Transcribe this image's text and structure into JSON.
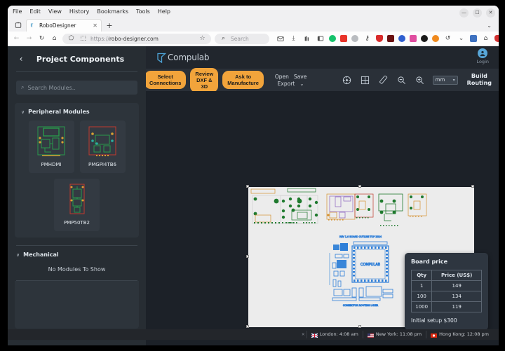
{
  "browser": {
    "menus": [
      "File",
      "Edit",
      "View",
      "History",
      "Bookmarks",
      "Tools",
      "Help"
    ],
    "window_controls": [
      {
        "name": "minimize",
        "glyph": "—"
      },
      {
        "name": "maximize",
        "glyph": "☐"
      },
      {
        "name": "close",
        "glyph": "✕"
      }
    ],
    "tab": {
      "title": "RoboDesigner",
      "favicon": "compulab-favicon",
      "close_glyph": "✕"
    },
    "new_tab_glyph": "+",
    "list_all_tabs_glyph": "⌄",
    "nav": {
      "back_glyph": "←",
      "forward_glyph": "→",
      "reload_glyph": "↻",
      "home_glyph": "⌂",
      "shield_glyph": "⬠",
      "lock_glyph": "⬚",
      "url_scheme": "https://",
      "url_host": "robo-designer.com",
      "bookmark_glyph": "☆",
      "search_placeholder": "Search",
      "search_glyph": "⌕"
    },
    "extensions": [
      {
        "name": "pocket-icon",
        "color": "#ffffff",
        "glyph": "✉"
      },
      {
        "name": "downloads-icon",
        "color": "#ffffff",
        "glyph": "⤓"
      },
      {
        "name": "library-icon",
        "color": "#ffffff",
        "glyph": "‖"
      },
      {
        "name": "sidebar-icon",
        "color": "#ffffff",
        "glyph": "◫"
      },
      {
        "name": "grammar-extension-icon",
        "color": "#15c26b",
        "glyph": ""
      },
      {
        "name": "red-extension-icon",
        "color": "#e8342a",
        "glyph": ""
      },
      {
        "name": "gray-extension-icon",
        "color": "#b9bcc0",
        "glyph": ""
      },
      {
        "name": "key-extension-icon",
        "color": "#ffffff",
        "glyph": "⚷"
      },
      {
        "name": "shield-extension-icon",
        "color": "#d92b2b",
        "glyph": ""
      },
      {
        "name": "dark-red-extension-icon",
        "color": "#6b1212",
        "glyph": ""
      },
      {
        "name": "blue-extension-icon",
        "color": "#2f5fd0",
        "glyph": ""
      },
      {
        "name": "pink-extension-icon",
        "color": "#e04ea0",
        "glyph": ""
      },
      {
        "name": "black-extension-icon",
        "color": "#1a1a1a",
        "glyph": ""
      },
      {
        "name": "orange-extension-icon",
        "color": "#f08a1e",
        "glyph": ""
      },
      {
        "name": "history-icon",
        "color": "#ffffff",
        "glyph": "↺"
      },
      {
        "name": "history-dropdown-icon",
        "color": "#ffffff",
        "glyph": "⌄"
      },
      {
        "name": "picture-extension-icon",
        "color": "#3f72c0",
        "glyph": ""
      },
      {
        "name": "home-extension-icon",
        "color": "#ffffff",
        "glyph": "⌂"
      },
      {
        "name": "heart-extension-icon",
        "color": "#d32f2f",
        "glyph": ""
      },
      {
        "name": "overflow-menu-icon",
        "color": "#ffffff",
        "glyph": "»"
      },
      {
        "name": "app-menu-icon",
        "color": "#9aa0a6",
        "glyph": "■"
      }
    ]
  },
  "sidebar": {
    "back_glyph": "‹",
    "title": "Project Components",
    "search": {
      "placeholder": "Search Modules..",
      "icon_glyph": "⌕"
    },
    "sections": [
      {
        "title": "Peripheral Modules",
        "chevron": "∨",
        "modules": [
          {
            "name": "PMHDMI",
            "thumb": "pcb-green"
          },
          {
            "name": "PMGPI4TB6",
            "thumb": "pcb-red"
          },
          {
            "name": "PMP50TB2",
            "thumb": "pcb-tall"
          }
        ]
      },
      {
        "title": "Mechanical",
        "chevron": "∨",
        "empty_text": "No Modules To Show",
        "modules": []
      }
    ]
  },
  "app": {
    "brand": "Compulab",
    "login": {
      "label": "Login",
      "avatar_icon": "user-avatar-icon"
    },
    "toolbar": {
      "buttons": [
        {
          "name": "select-connections",
          "label": "Select\nConnections"
        },
        {
          "name": "review-dxf-3d",
          "label": "Review\nDXF &\n3D"
        },
        {
          "name": "ask-to-manufacture",
          "label": "Ask to\nManufacture"
        }
      ],
      "menu_items": [
        "Open",
        "Save",
        "Export"
      ],
      "export_caret": "⌄",
      "icons": [
        {
          "name": "target-icon",
          "glyph": "⊕"
        },
        {
          "name": "grid-icon",
          "glyph": "⊞"
        },
        {
          "name": "ruler-icon",
          "glyph": "╱"
        },
        {
          "name": "zoom-out-icon",
          "glyph": "⌕"
        },
        {
          "name": "zoom-in-icon",
          "glyph": "⌕"
        }
      ],
      "unit": {
        "value": "mm",
        "caret": "▾"
      },
      "build_routing_label": "Build\nRouting"
    }
  },
  "price_card": {
    "title": "Board price",
    "columns": [
      "Qty",
      "Price (US$)"
    ],
    "rows": [
      [
        "1",
        "149"
      ],
      [
        "100",
        "134"
      ],
      [
        "1000",
        "119"
      ]
    ],
    "footer": "Initial setup $300"
  },
  "statusbar": {
    "pin_glyph": "×",
    "clocks": [
      {
        "city": "London",
        "time": "4:08 am",
        "flag": "uk"
      },
      {
        "city": "New York",
        "time": "11:08 pm",
        "flag": "us"
      },
      {
        "city": "Hong Kong",
        "time": "12:08 pm",
        "flag": "hk"
      }
    ]
  },
  "colors": {
    "accent_orange": "#f2a43b",
    "app_bg": "#1c2128",
    "sidebar_bg": "#272d33",
    "board_bg": "#ececec",
    "brand_blue": "#58a6d8"
  }
}
